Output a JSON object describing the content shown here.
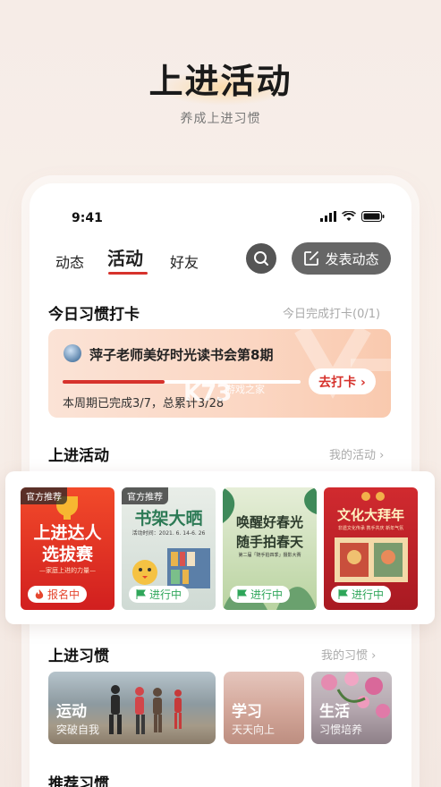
{
  "hero": {
    "title": "上进活动",
    "subtitle": "养成上进习惯"
  },
  "status": {
    "time": "9:41"
  },
  "tabs": [
    {
      "label": "动态"
    },
    {
      "label": "活动"
    },
    {
      "label": "好友"
    }
  ],
  "toolbar": {
    "post_label": "发表动态"
  },
  "checkin": {
    "section_title": "今日习惯打卡",
    "section_right": "今日完成打卡(0/1)",
    "name": "萍子老师美好时光读书会第8期",
    "button": "去打卡 ›",
    "stats": "本周期已完成3/7，总累计3/28",
    "progress": 0.43,
    "watermark": "K73",
    "watermark_sub": "游戏之家"
  },
  "activities": {
    "section_title": "上进活动",
    "section_right": "我的活动 ›",
    "items": [
      {
        "tag": "官方推荐",
        "big1": "上进达人",
        "big2": "选拔赛",
        "small": "—家庭上进的力量—",
        "badge": "报名中",
        "color": "#e0361f"
      },
      {
        "tag": "官方推荐",
        "big1": "书架大晒",
        "big2": "",
        "small": "活动时间：2021. 6. 14-6. 26",
        "badge": "进行中",
        "color": "#e7ece8"
      },
      {
        "tag": "",
        "big1": "唤醒好春光",
        "big2": "随手拍春天",
        "small": "第二届「随手拍四季」摄影大赛",
        "badge": "进行中",
        "color": "#dfe8cf"
      },
      {
        "tag": "",
        "big1": "文化大拜年",
        "big2": "",
        "small": "非遗文化传承 携手共庆 新年气氛",
        "badge": "进行中",
        "color": "#c9232b"
      }
    ]
  },
  "habits": {
    "section_title": "上进习惯",
    "section_right": "我的习惯 ›",
    "items": [
      {
        "title": "运动",
        "sub": "突破自我"
      },
      {
        "title": "学习",
        "sub": "天天向上"
      },
      {
        "title": "生活",
        "sub": "习惯培养"
      }
    ]
  },
  "recommend": {
    "section_title": "推荐习惯"
  },
  "colors": {
    "accent": "#d6322c",
    "badge_green": "#2fa65a",
    "badge_orange": "#e5452d"
  }
}
